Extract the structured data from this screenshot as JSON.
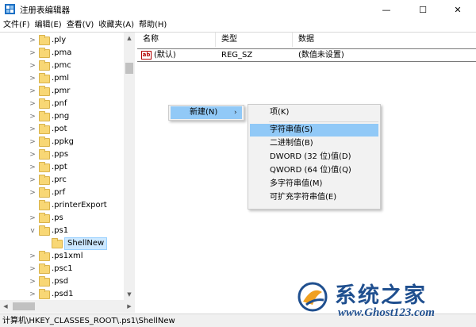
{
  "window": {
    "title": "注册表编辑器",
    "min_glyph": "—",
    "max_glyph": "☐",
    "close_glyph": "✕"
  },
  "menubar": [
    "文件(F)",
    "编辑(E)",
    "查看(V)",
    "收藏夹(A)",
    "帮助(H)"
  ],
  "tree": {
    "items": [
      {
        "label": ".ply",
        "expander": ">",
        "selected": false
      },
      {
        "label": ".pma",
        "expander": ">",
        "selected": false
      },
      {
        "label": ".pmc",
        "expander": ">",
        "selected": false
      },
      {
        "label": ".pml",
        "expander": ">",
        "selected": false
      },
      {
        "label": ".pmr",
        "expander": ">",
        "selected": false
      },
      {
        "label": ".pnf",
        "expander": ">",
        "selected": false
      },
      {
        "label": ".png",
        "expander": ">",
        "selected": false
      },
      {
        "label": ".pot",
        "expander": ">",
        "selected": false
      },
      {
        "label": ".ppkg",
        "expander": ">",
        "selected": false
      },
      {
        "label": ".pps",
        "expander": ">",
        "selected": false
      },
      {
        "label": ".ppt",
        "expander": ">",
        "selected": false
      },
      {
        "label": ".prc",
        "expander": ">",
        "selected": false
      },
      {
        "label": ".prf",
        "expander": ">",
        "selected": false
      },
      {
        "label": ".printerExport",
        "expander": "",
        "selected": false
      },
      {
        "label": ".ps",
        "expander": ">",
        "selected": false
      },
      {
        "label": ".ps1",
        "expander": "v",
        "selected": false
      },
      {
        "label": "ShellNew",
        "expander": "",
        "selected": true
      },
      {
        "label": ".ps1xml",
        "expander": ">",
        "selected": false
      },
      {
        "label": ".psc1",
        "expander": ">",
        "selected": false
      },
      {
        "label": ".psd",
        "expander": ">",
        "selected": false
      },
      {
        "label": ".psd1",
        "expander": ">",
        "selected": false
      }
    ]
  },
  "list": {
    "columns": [
      "名称",
      "类型",
      "数据"
    ],
    "rows": [
      {
        "icon": "ab",
        "name": "(默认)",
        "type": "REG_SZ",
        "data": "(数值未设置)"
      }
    ]
  },
  "context_menu": {
    "item_label": "新建(N)",
    "arrow": "›"
  },
  "submenu": {
    "items": [
      {
        "label": "项(K)",
        "highlight": false
      },
      {
        "label": "字符串值(S)",
        "highlight": true
      },
      {
        "label": "二进制值(B)",
        "highlight": false
      },
      {
        "label": "DWORD (32 位)值(D)",
        "highlight": false
      },
      {
        "label": "QWORD (64 位)值(Q)",
        "highlight": false
      },
      {
        "label": "多字符串值(M)",
        "highlight": false
      },
      {
        "label": "可扩充字符串值(E)",
        "highlight": false
      }
    ]
  },
  "statusbar": {
    "path": "计算机\\HKEY_CLASSES_ROOT\\.ps1\\ShellNew"
  },
  "watermark": {
    "title": "系统之家",
    "url": "www.Ghost123.com"
  },
  "colors": {
    "selection": "#91c9f7",
    "tree_selection": "#cce8ff",
    "folder": "#f8d775",
    "watermark": "#1f4f8f"
  }
}
